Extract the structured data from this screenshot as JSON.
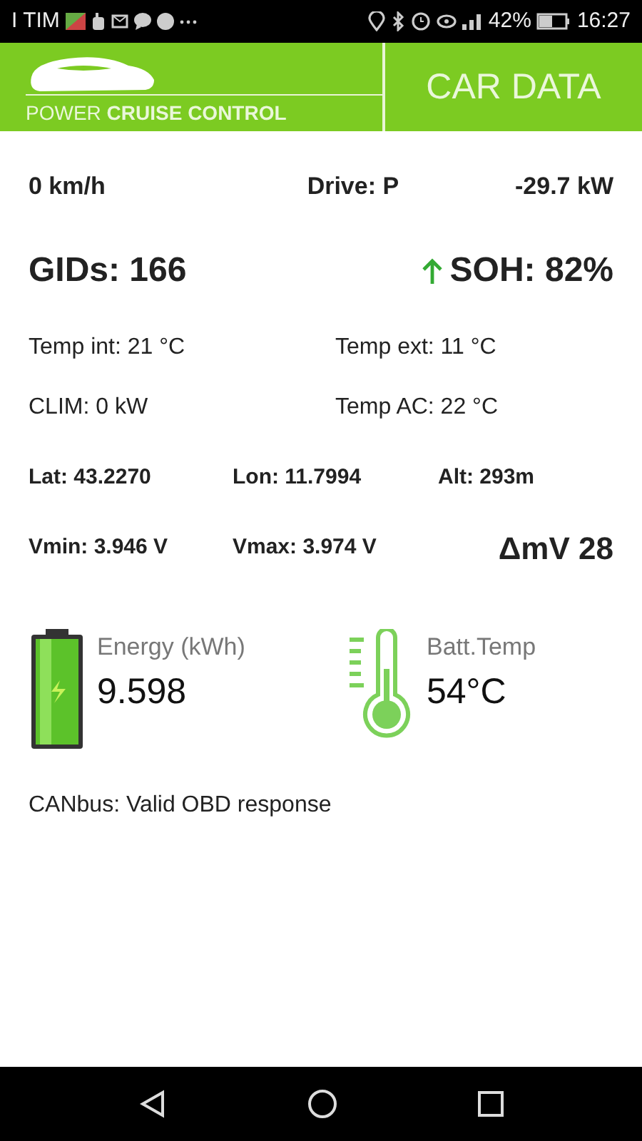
{
  "status_bar": {
    "carrier": "I TIM",
    "battery": "42%",
    "time": "16:27"
  },
  "header": {
    "logo_text": "POWER **CRUISE CONTROL**",
    "title": "CAR DATA"
  },
  "top_row": [
    "0 km/h",
    "Drive: P",
    "-29.7 kW"
  ],
  "gids": "GIDs: 166",
  "soh": "SOH: 82%",
  "temps": [
    [
      "Temp int: 21 °C",
      "Temp ext: 11 °C"
    ],
    [
      "CLIM: 0 kW",
      "Temp AC: 22 °C"
    ]
  ],
  "position": [
    "Lat: 43.2270",
    "Lon: 11.7994",
    "Alt: 293m"
  ],
  "voltages": {
    "vmin": "Vmin: 3.946 V",
    "vmax": "Vmax: 3.974 V",
    "delta": "ΔmV 28"
  },
  "energy": {
    "label": "Energy (kWh)",
    "value": "9.598"
  },
  "batt_temp": {
    "label": "Batt.Temp",
    "value": "54°C"
  },
  "canbus": "CANbus: Valid OBD response"
}
